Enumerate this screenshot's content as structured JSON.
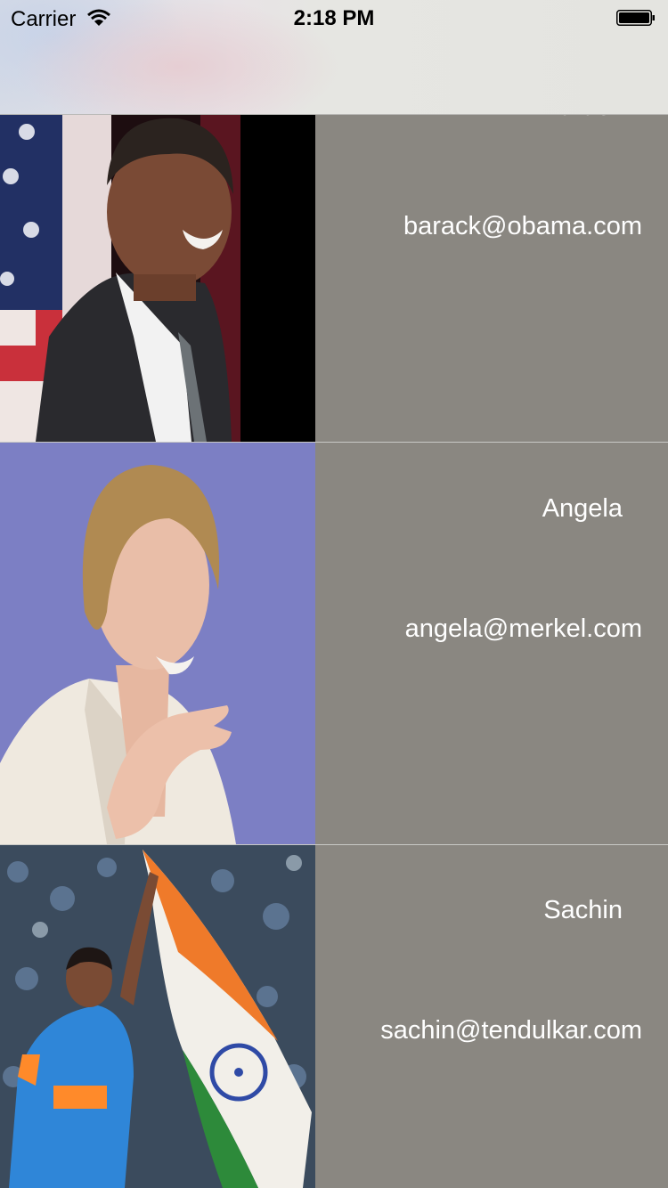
{
  "status_bar": {
    "carrier": "Carrier",
    "time": "2:18 PM",
    "wifi_icon": "wifi-icon",
    "battery_icon": "battery-icon"
  },
  "colors": {
    "cell_background": "#8a8781",
    "text": "#ffffff"
  },
  "contacts": [
    {
      "name": "Barack",
      "email": "barack@obama.com",
      "photo": "photo-barack-obama"
    },
    {
      "name": "Angela",
      "email": "angela@merkel.com",
      "photo": "photo-angela-merkel"
    },
    {
      "name": "Sachin",
      "email": "sachin@tendulkar.com",
      "photo": "photo-sachin-tendulkar"
    }
  ]
}
